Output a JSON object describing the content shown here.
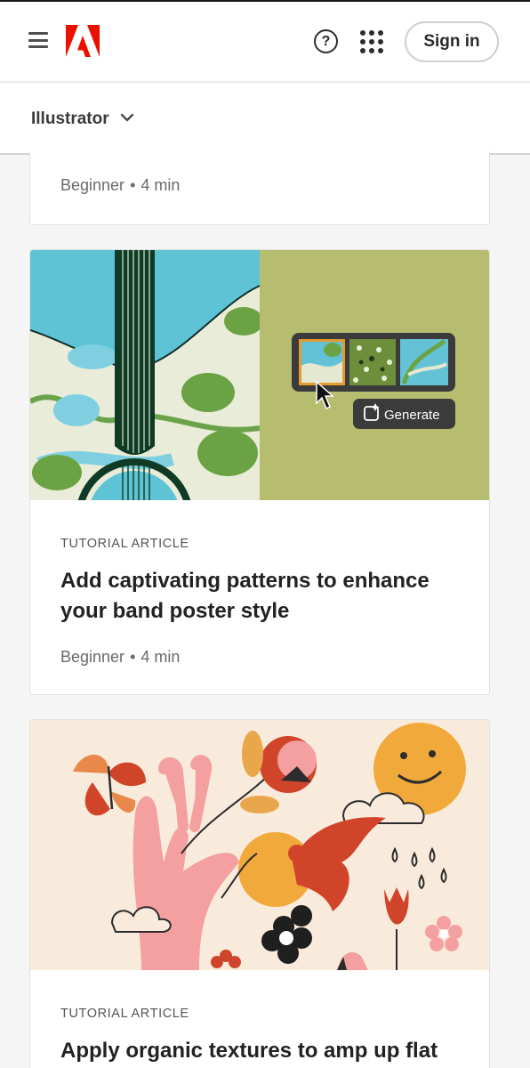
{
  "header": {
    "signin_label": "Sign in",
    "help_glyph": "?",
    "menu_icon": "hamburger-menu-icon",
    "logo_icon": "adobe-logo",
    "apps_icon": "app-grid-icon"
  },
  "subnav": {
    "product_label": "Illustrator",
    "dropdown_icon": "chevron-down-icon"
  },
  "cards": [
    {
      "level": "Beginner",
      "separator": "•",
      "duration": "4 min"
    },
    {
      "kind": "TUTORIAL ARTICLE",
      "title": "Add captivating patterns to enhance your band poster style",
      "level": "Beginner",
      "separator": "•",
      "duration": "4 min",
      "image_overlay_button": "Generate"
    },
    {
      "kind": "TUTORIAL ARTICLE",
      "title": "Apply organic textures to amp up flat"
    }
  ],
  "colors": {
    "adobe_red": "#eb1000",
    "sky": "#5fc3d6",
    "olive": "#b7bd6e",
    "guitar_dark": "#0f3a25",
    "cream": "#f8ebdc"
  }
}
